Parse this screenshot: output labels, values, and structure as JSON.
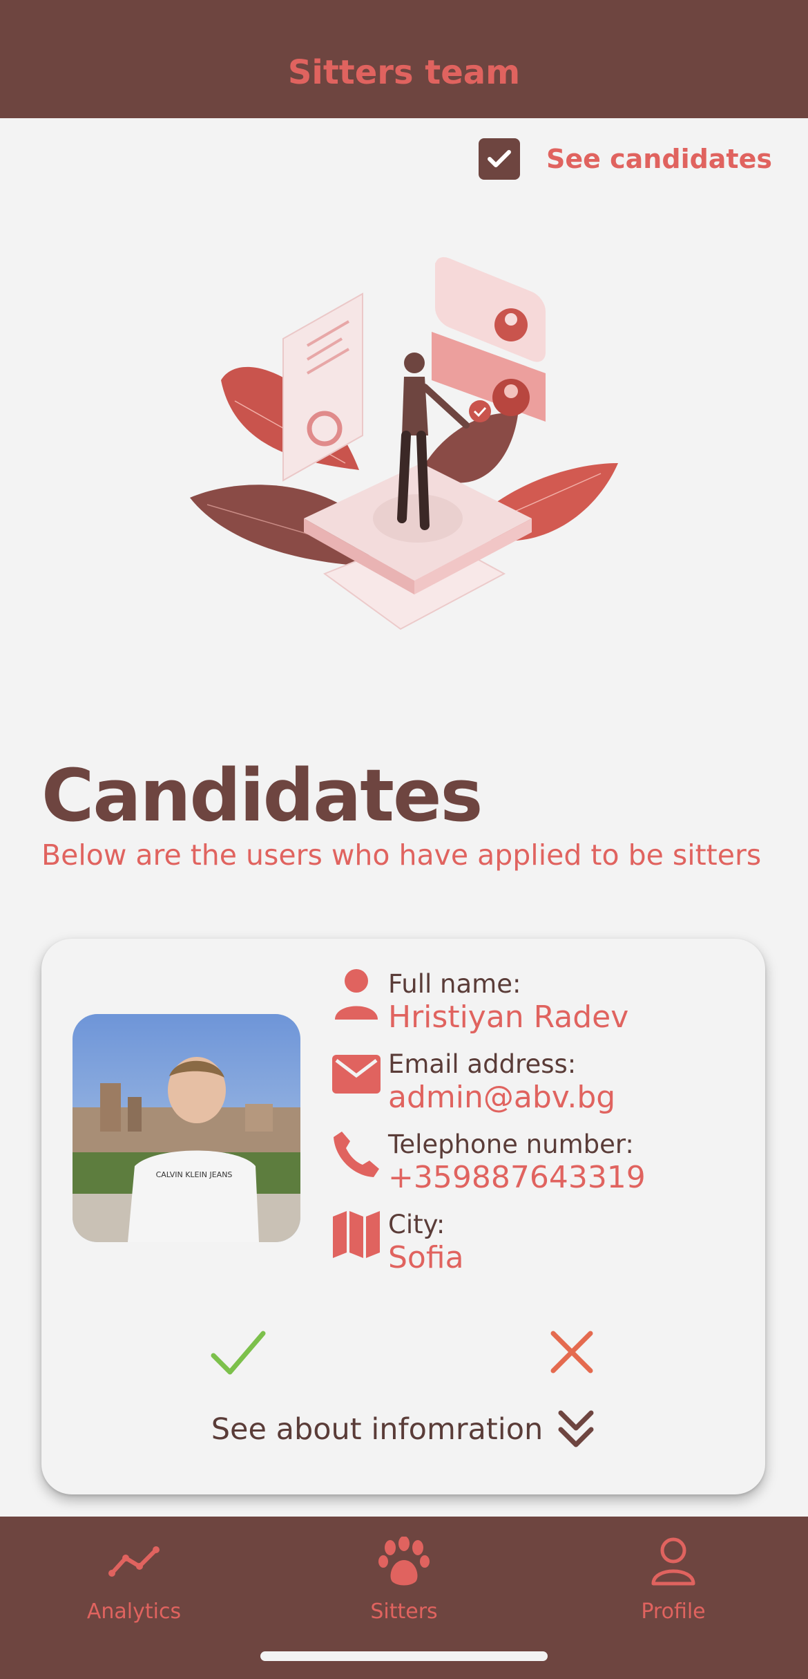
{
  "header": {
    "title": "Sitters team"
  },
  "toggle": {
    "label": "See candidates",
    "checked": true
  },
  "main": {
    "title": "Candidates",
    "subtitle": "Below are the users who have applied to be sitters"
  },
  "candidate": {
    "photo_shirt_text": "CALVIN KLEIN JEANS",
    "fields": [
      {
        "label": "Full name:",
        "value": "Hristiyan Radev",
        "icon": "person-icon"
      },
      {
        "label": "Email address:",
        "value": "admin@abv.bg",
        "icon": "envelope-icon"
      },
      {
        "label": "Telephone number:",
        "value": "+359887643319",
        "icon": "phone-icon"
      },
      {
        "label": "City:",
        "value": "Sofia",
        "icon": "map-icon"
      }
    ],
    "about_label": "See about infomration",
    "approve_icon": "checkmark-icon",
    "reject_icon": "x-icon"
  },
  "tabbar": {
    "tabs": [
      {
        "label": "Analytics",
        "icon": "chart-line-icon"
      },
      {
        "label": "Sitters",
        "icon": "paw-icon"
      },
      {
        "label": "Profile",
        "icon": "person-outline-icon"
      }
    ]
  },
  "colors": {
    "primary": "#6e4540",
    "accent": "#e0635f",
    "background": "#f3f3f3",
    "approve": "#7cc04b",
    "reject": "#e46a4f"
  }
}
